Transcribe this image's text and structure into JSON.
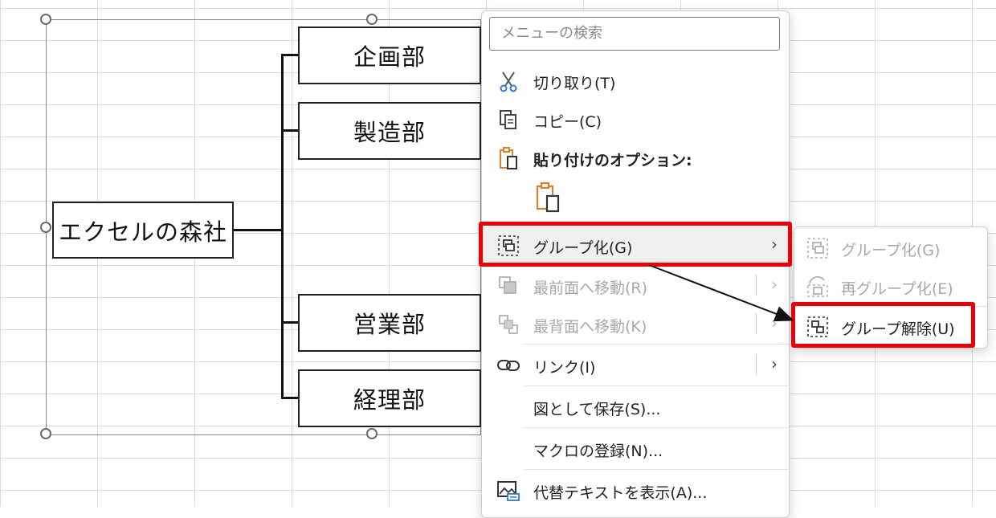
{
  "org_chart": {
    "root": "エクセルの森社",
    "departments": [
      "企画部",
      "製造部",
      "営業部",
      "経理部"
    ]
  },
  "context_menu": {
    "search_placeholder": "メニューの検索",
    "items": [
      {
        "label": "切り取り(T)",
        "icon": "scissors-icon",
        "enabled": true
      },
      {
        "label": "コピー(C)",
        "icon": "copy-icon",
        "enabled": true
      },
      {
        "label": "貼り付けのオプション:",
        "icon": "paste-icon",
        "enabled": true
      },
      {
        "label": "グループ化(G)",
        "icon": "group-icon",
        "enabled": true,
        "submenu": true
      },
      {
        "label": "最前面へ移動(R)",
        "icon": "bring-to-front-icon",
        "enabled": false,
        "submenu": true
      },
      {
        "label": "最背面へ移動(K)",
        "icon": "send-to-back-icon",
        "enabled": false,
        "submenu": true
      },
      {
        "label": "リンク(I)",
        "icon": "link-icon",
        "enabled": true,
        "submenu": true
      },
      {
        "label": "図として保存(S)...",
        "enabled": true
      },
      {
        "label": "マクロの登録(N)...",
        "enabled": true
      },
      {
        "label": "代替テキストを表示(A)...",
        "icon": "alt-text-icon",
        "enabled": true
      }
    ]
  },
  "group_submenu": {
    "items": [
      {
        "label": "グループ化(G)",
        "icon": "group-icon",
        "enabled": false
      },
      {
        "label": "再グループ化(E)",
        "icon": "regroup-icon",
        "enabled": false
      },
      {
        "label": "グループ解除(U)",
        "icon": "ungroup-icon",
        "enabled": true
      }
    ]
  },
  "colors": {
    "highlight": "#e8000b",
    "icon_orange": "#d9822b",
    "icon_blue": "#2e7bcf"
  }
}
